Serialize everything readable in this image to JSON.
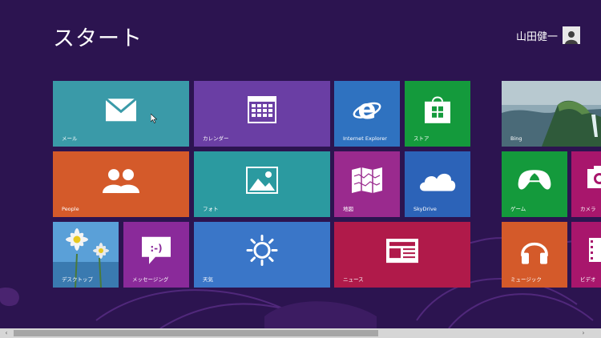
{
  "screen": {
    "title": "スタート"
  },
  "user": {
    "name": "山田健一",
    "avatar_icon": "user-avatar-icon"
  },
  "tiles": {
    "mail": {
      "label": "メール",
      "color": "#3a9aa8",
      "icon": "mail-icon"
    },
    "calendar": {
      "label": "カレンダー",
      "color": "#6a3ea4",
      "icon": "calendar-icon"
    },
    "ie": {
      "label": "Internet Explorer",
      "color": "#2f72c0",
      "icon": "internet-explorer-icon"
    },
    "store": {
      "label": "ストア",
      "color": "#149a3c",
      "icon": "store-icon"
    },
    "bing": {
      "label": "Bing",
      "color": "#5f7f8f",
      "icon": "bing-landscape-image"
    },
    "people": {
      "label": "People",
      "color": "#d45a2a",
      "icon": "people-icon"
    },
    "photos": {
      "label": "フォト",
      "color": "#2b9aa0",
      "icon": "photos-icon"
    },
    "maps": {
      "label": "地図",
      "color": "#9a2a8e",
      "icon": "maps-icon"
    },
    "skydrive": {
      "label": "SkyDrive",
      "color": "#2c63b8",
      "icon": "skydrive-cloud-icon"
    },
    "games": {
      "label": "ゲーム",
      "color": "#149a3c",
      "icon": "xbox-controller-icon"
    },
    "camera": {
      "label": "カメラ",
      "color": "#a8166c",
      "icon": "camera-icon"
    },
    "desktop": {
      "label": "デスクトップ",
      "color": "#4a8ac8",
      "icon": "desktop-daisy-image"
    },
    "messaging": {
      "label": "メッセージング",
      "color": "#8a2a9a",
      "icon": "messaging-icon"
    },
    "weather": {
      "label": "天気",
      "color": "#3a76c8",
      "icon": "weather-sun-icon"
    },
    "news": {
      "label": "ニュース",
      "color": "#b01a4a",
      "icon": "news-icon"
    },
    "music": {
      "label": "ミュージック",
      "color": "#d45a2a",
      "icon": "headphones-icon"
    },
    "video": {
      "label": "ビデオ",
      "color": "#a8166c",
      "icon": "video-icon"
    }
  },
  "scrollbar": {
    "left_arrow": "‹",
    "right_arrow": "›"
  }
}
